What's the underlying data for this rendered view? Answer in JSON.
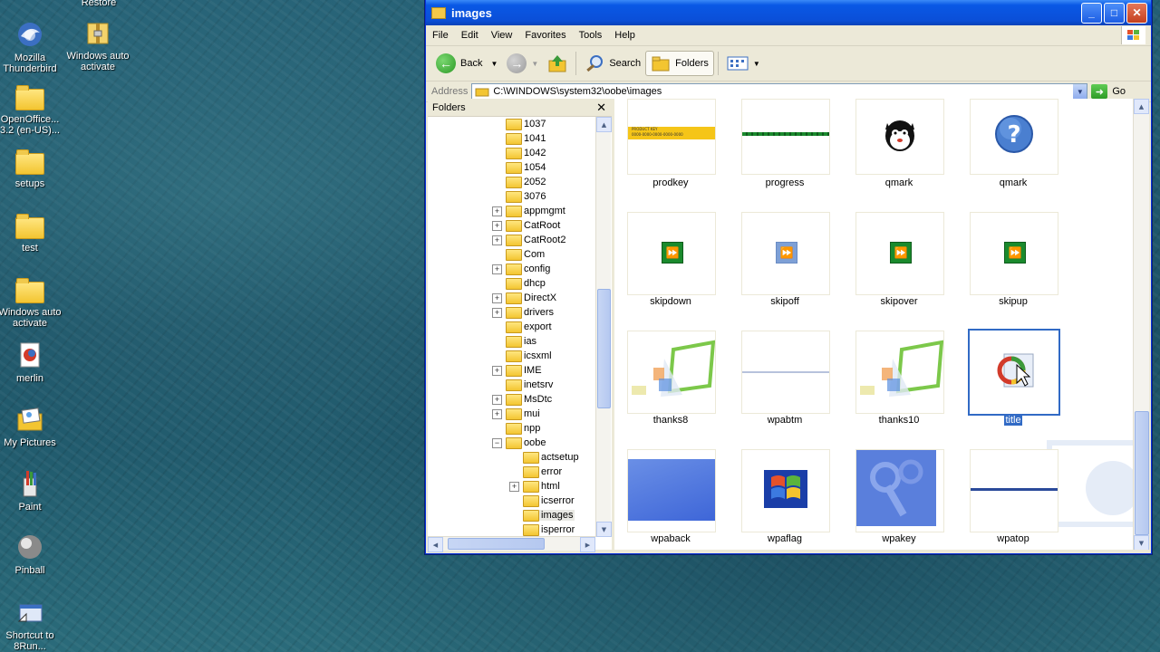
{
  "desktop": {
    "top_label": "Restore",
    "icons": [
      {
        "name": "mozilla-thunderbird",
        "label": "Mozilla Thunderbird"
      },
      {
        "name": "windows-auto-activate-top",
        "label": "Windows auto activate"
      },
      {
        "name": "openoffice",
        "label": "OpenOffice... 3.2 (en-US)..."
      },
      {
        "name": "setups",
        "label": "setups"
      },
      {
        "name": "test",
        "label": "test"
      },
      {
        "name": "windows-auto-activate",
        "label": "Windows auto activate"
      },
      {
        "name": "merlin",
        "label": "merlin"
      },
      {
        "name": "my-pictures",
        "label": "My Pictures"
      },
      {
        "name": "paint",
        "label": "Paint"
      },
      {
        "name": "pinball",
        "label": "Pinball"
      },
      {
        "name": "shortcut-run",
        "label": "Shortcut to 8Run..."
      }
    ]
  },
  "window": {
    "title": "images",
    "menu": [
      "File",
      "Edit",
      "View",
      "Favorites",
      "Tools",
      "Help"
    ],
    "toolbar": {
      "back": "Back",
      "search": "Search",
      "folders": "Folders"
    },
    "address": {
      "label": "Address",
      "value": "C:\\WINDOWS\\system32\\oobe\\images",
      "go": "Go"
    },
    "folders_pane": {
      "title": "Folders",
      "tree": [
        {
          "label": "1037",
          "level": 0,
          "expander": ""
        },
        {
          "label": "1041",
          "level": 0,
          "expander": ""
        },
        {
          "label": "1042",
          "level": 0,
          "expander": ""
        },
        {
          "label": "1054",
          "level": 0,
          "expander": ""
        },
        {
          "label": "2052",
          "level": 0,
          "expander": ""
        },
        {
          "label": "3076",
          "level": 0,
          "expander": ""
        },
        {
          "label": "appmgmt",
          "level": 0,
          "expander": "+"
        },
        {
          "label": "CatRoot",
          "level": 0,
          "expander": "+"
        },
        {
          "label": "CatRoot2",
          "level": 0,
          "expander": "+"
        },
        {
          "label": "Com",
          "level": 0,
          "expander": ""
        },
        {
          "label": "config",
          "level": 0,
          "expander": "+"
        },
        {
          "label": "dhcp",
          "level": 0,
          "expander": ""
        },
        {
          "label": "DirectX",
          "level": 0,
          "expander": "+"
        },
        {
          "label": "drivers",
          "level": 0,
          "expander": "+"
        },
        {
          "label": "export",
          "level": 0,
          "expander": ""
        },
        {
          "label": "ias",
          "level": 0,
          "expander": ""
        },
        {
          "label": "icsxml",
          "level": 0,
          "expander": ""
        },
        {
          "label": "IME",
          "level": 0,
          "expander": "+"
        },
        {
          "label": "inetsrv",
          "level": 0,
          "expander": ""
        },
        {
          "label": "MsDtc",
          "level": 0,
          "expander": "+"
        },
        {
          "label": "mui",
          "level": 0,
          "expander": "+"
        },
        {
          "label": "npp",
          "level": 0,
          "expander": ""
        },
        {
          "label": "oobe",
          "level": 0,
          "expander": "-"
        },
        {
          "label": "actsetup",
          "level": 1,
          "expander": ""
        },
        {
          "label": "error",
          "level": 1,
          "expander": ""
        },
        {
          "label": "html",
          "level": 1,
          "expander": "+"
        },
        {
          "label": "icserror",
          "level": 1,
          "expander": ""
        },
        {
          "label": "images",
          "level": 1,
          "expander": "",
          "selected": true
        },
        {
          "label": "isperror",
          "level": 1,
          "expander": ""
        }
      ]
    },
    "files": [
      {
        "label": "prodkey",
        "kind": "prodkey"
      },
      {
        "label": "progress",
        "kind": "progress"
      },
      {
        "label": "qmark",
        "kind": "cat"
      },
      {
        "label": "qmark",
        "kind": "question"
      },
      {
        "label": "skipdown",
        "kind": "skip"
      },
      {
        "label": "skipoff",
        "kind": "skipoff"
      },
      {
        "label": "skipover",
        "kind": "skip"
      },
      {
        "label": "skipup",
        "kind": "skip"
      },
      {
        "label": "thanks8",
        "kind": "thanks"
      },
      {
        "label": "wpabtm",
        "kind": "line"
      },
      {
        "label": "thanks10",
        "kind": "thanks"
      },
      {
        "label": "title",
        "kind": "title",
        "selected": true
      },
      {
        "label": "wpaback",
        "kind": "wpaback"
      },
      {
        "label": "wpaflag",
        "kind": "flag"
      },
      {
        "label": "wpakey",
        "kind": "key"
      },
      {
        "label": "wpatop",
        "kind": "wpatop"
      }
    ],
    "prodkey_text": "PRODUCT KEY",
    "prodkey_value": "0000-0000-0000-0000-0000"
  }
}
